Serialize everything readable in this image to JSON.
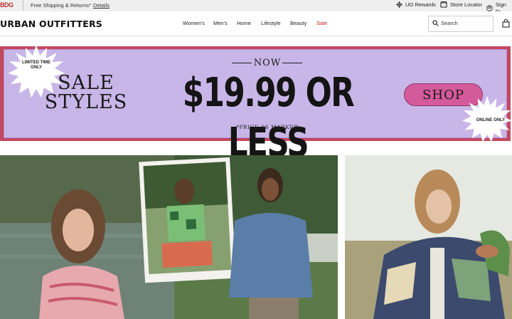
{
  "utility": {
    "logo": "BDG",
    "shipping_text": "Free Shipping & Returns*",
    "details_link": "Details",
    "rewards": "UO Rewards",
    "store_locator": "Store Locator",
    "sign_in": "Sign In"
  },
  "header": {
    "logo": "URBAN OUTFITTERS",
    "nav": [
      "Women's",
      "Men's",
      "Home",
      "Lifestyle",
      "Beauty",
      "Sale"
    ],
    "search_label": "Search"
  },
  "banner": {
    "badge_left": "LIMITED TIME ONLY",
    "sale_styles": "SALE STYLES",
    "now": "NOW",
    "price": "$19.99 OR LESS",
    "note": "*PRICE AS MARKED",
    "shop": "SHOP",
    "badge_right": "ONLINE ONLY"
  },
  "colors": {
    "banner_bg": "#c9b6e8",
    "banner_border": "#c4485e",
    "shop_button": "#d45a9b",
    "sale_link": "#c91a1a"
  }
}
